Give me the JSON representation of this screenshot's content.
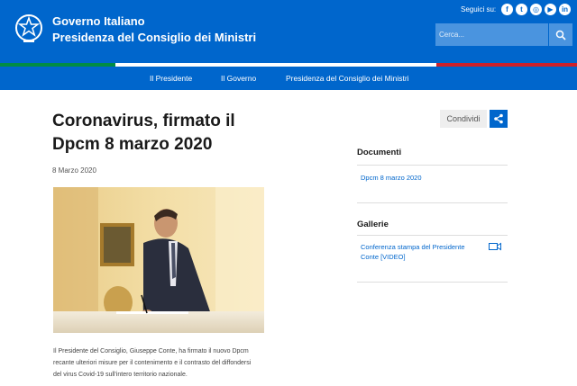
{
  "header": {
    "brand_line1": "Governo Italiano",
    "brand_line2": "Presidenza del Consiglio dei Ministri",
    "social_label": "Seguici su:",
    "social_icons": [
      "facebook-icon",
      "twitter-icon",
      "instagram-icon",
      "youtube-icon",
      "linkedin-icon"
    ],
    "search_placeholder": "Cerca..."
  },
  "nav": {
    "items": [
      "Il Presidente",
      "Il Governo",
      "Presidenza del Consiglio dei Ministri"
    ]
  },
  "article": {
    "title_line1": "Coronavirus, firmato il",
    "title_line2": "Dpcm 8 marzo 2020",
    "date": "8 Marzo 2020",
    "intro_line1": "Il Presidente del Consiglio, Giuseppe Conte, ha firmato il nuovo Dpcm",
    "intro_line2": "recante ulteriori misure per il contenimento e il contrasto del diffondersi",
    "intro_line3": "del virus Covid-19  sull'intero territorio nazionale."
  },
  "sidebar": {
    "share_label": "Condividi",
    "documenti_title": "Documenti",
    "documenti_link": "Dpcm 8 marzo 2020",
    "gallerie_title": "Gallerie",
    "gallerie_link_line1": "Conferenza stampa del Presidente",
    "gallerie_link_line2": "Conte  [VIDEO]"
  },
  "colors": {
    "primary": "#0066cc",
    "flag_green": "#008c45",
    "flag_red": "#cd212a"
  }
}
